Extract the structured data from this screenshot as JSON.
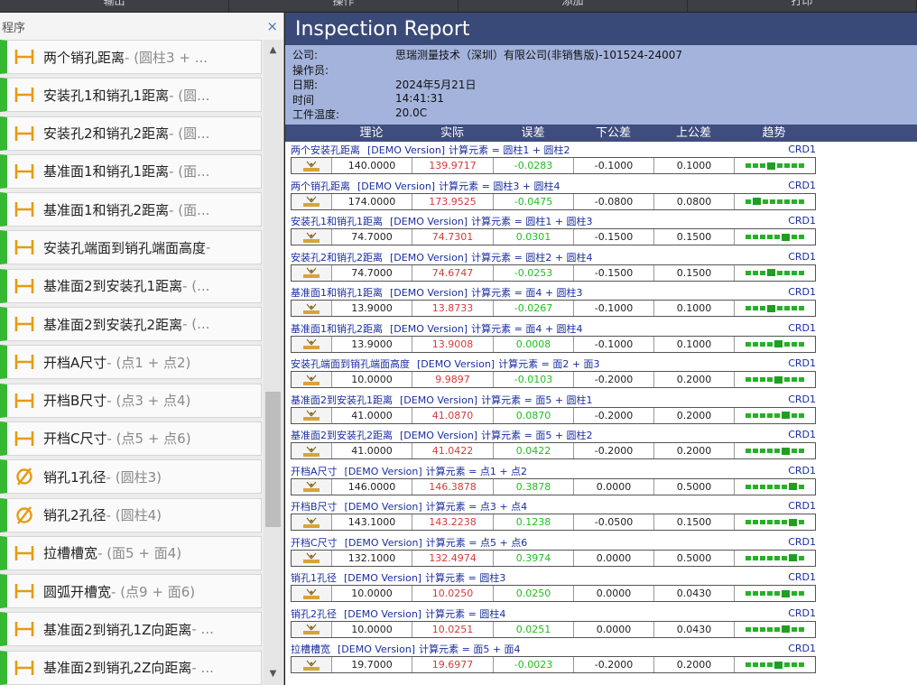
{
  "topbar": {
    "tabs": [
      "输出",
      "操作",
      "添加",
      "打印"
    ]
  },
  "left_panel": {
    "title": "程序",
    "close_glyph": "×",
    "scroll_up": "▲",
    "scroll_down": "▼",
    "items": [
      {
        "icon": "distance-icon",
        "name": "两个销孔距离",
        "detail": " - (圆柱3 + ..."
      },
      {
        "icon": "distance-icon",
        "name": "安装孔1和销孔1距离",
        "detail": " - (圆..."
      },
      {
        "icon": "distance-icon",
        "name": "安装孔2和销孔2距离",
        "detail": " - (圆..."
      },
      {
        "icon": "distance-icon",
        "name": "基准面1和销孔1距离",
        "detail": " - (面..."
      },
      {
        "icon": "distance-icon",
        "name": "基准面1和销孔2距离",
        "detail": " - (面..."
      },
      {
        "icon": "distance-icon",
        "name": "安装孔端面到销孔端面高度",
        "detail": " -"
      },
      {
        "icon": "distance-icon",
        "name": "基准面2到安装孔1距离",
        "detail": " - (..."
      },
      {
        "icon": "distance-icon",
        "name": "基准面2到安装孔2距离",
        "detail": " - (..."
      },
      {
        "icon": "distance-icon",
        "name": "开档A尺寸",
        "detail": " - (点1 + 点2)"
      },
      {
        "icon": "distance-icon",
        "name": "开档B尺寸",
        "detail": " - (点3 + 点4)"
      },
      {
        "icon": "distance-icon",
        "name": "开档C尺寸",
        "detail": " - (点5 + 点6)"
      },
      {
        "icon": "diameter-icon",
        "name": "销孔1孔径",
        "detail": " - (圆柱3)"
      },
      {
        "icon": "diameter-icon",
        "name": "销孔2孔径",
        "detail": " - (圆柱4)"
      },
      {
        "icon": "distance-icon",
        "name": "拉槽槽宽",
        "detail": " - (面5 + 面4)"
      },
      {
        "icon": "distance-icon",
        "name": "圆弧开槽宽",
        "detail": " - (点9 + 面6)"
      },
      {
        "icon": "distance-icon",
        "name": "基准面2到销孔1Z向距离",
        "detail": " - ..."
      },
      {
        "icon": "distance-icon",
        "name": "基准面2到销孔2Z向距离",
        "detail": " - ..."
      }
    ]
  },
  "report": {
    "title": "Inspection Report",
    "info": [
      {
        "label": "公司:",
        "value": "思瑞测量技术（深圳）有限公司(非销售版)-101524-24007"
      },
      {
        "label": "操作员:",
        "value": ""
      },
      {
        "label": "日期:",
        "value": "2024年5月21日"
      },
      {
        "label": "时间",
        "value": "14:41:31"
      },
      {
        "label": "工件温度:",
        "value": "20.0C"
      }
    ],
    "columns": [
      "理论",
      "实际",
      "误差",
      "下公差",
      "上公差",
      "趋势"
    ],
    "colors": {
      "header": "#3a4a78",
      "info_bg": "#a3b3dc",
      "actual": "#d63a3a",
      "error": "#1fbf1f"
    },
    "features": [
      {
        "name": "两个安装孔距离",
        "demo": "[DEMO Version]",
        "calc": "计算元素 = 圆柱1 + 圆柱2",
        "crd": "CRD1",
        "theory": "140.0000",
        "actual": "139.9717",
        "error": "-0.0283",
        "lower": "-0.1000",
        "upper": "0.1000",
        "trend": 3
      },
      {
        "name": "两个销孔距离",
        "demo": "[DEMO Version]",
        "calc": "计算元素 = 圆柱3 + 圆柱4",
        "crd": "CRD1",
        "theory": "174.0000",
        "actual": "173.9525",
        "error": "-0.0475",
        "lower": "-0.0800",
        "upper": "0.0800",
        "trend": 1
      },
      {
        "name": "安装孔1和销孔1距离",
        "demo": "[DEMO Version]",
        "calc": "计算元素 = 圆柱1 + 圆柱3",
        "crd": "CRD1",
        "theory": "74.7000",
        "actual": "74.7301",
        "error": "0.0301",
        "lower": "-0.1500",
        "upper": "0.1500",
        "trend": 5
      },
      {
        "name": "安装孔2和销孔2距离",
        "demo": "[DEMO Version]",
        "calc": "计算元素 = 圆柱2 + 圆柱4",
        "crd": "CRD1",
        "theory": "74.7000",
        "actual": "74.6747",
        "error": "-0.0253",
        "lower": "-0.1500",
        "upper": "0.1500",
        "trend": 3
      },
      {
        "name": "基准面1和销孔1距离",
        "demo": "[DEMO Version]",
        "calc": "计算元素 = 面4 + 圆柱3",
        "crd": "CRD1",
        "theory": "13.9000",
        "actual": "13.8733",
        "error": "-0.0267",
        "lower": "-0.1000",
        "upper": "0.1000",
        "trend": 3
      },
      {
        "name": "基准面1和销孔2距离",
        "demo": "[DEMO Version]",
        "calc": "计算元素 = 面4 + 圆柱4",
        "crd": "CRD1",
        "theory": "13.9000",
        "actual": "13.9008",
        "error": "0.0008",
        "lower": "-0.1000",
        "upper": "0.1000",
        "trend": 4
      },
      {
        "name": "安装孔端面到销孔端面高度",
        "demo": "[DEMO Version]",
        "calc": "计算元素 = 面2 + 面3",
        "crd": "CRD1",
        "theory": "10.0000",
        "actual": "9.9897",
        "error": "-0.0103",
        "lower": "-0.2000",
        "upper": "0.2000",
        "trend": 4
      },
      {
        "name": "基准面2到安装孔1距离",
        "demo": "[DEMO Version]",
        "calc": "计算元素 = 面5 + 圆柱1",
        "crd": "CRD1",
        "theory": "41.0000",
        "actual": "41.0870",
        "error": "0.0870",
        "lower": "-0.2000",
        "upper": "0.2000",
        "trend": 5
      },
      {
        "name": "基准面2到安装孔2距离",
        "demo": "[DEMO Version]",
        "calc": "计算元素 = 面5 + 圆柱2",
        "crd": "CRD1",
        "theory": "41.0000",
        "actual": "41.0422",
        "error": "0.0422",
        "lower": "-0.2000",
        "upper": "0.2000",
        "trend": 5
      },
      {
        "name": "开档A尺寸",
        "demo": "[DEMO Version]",
        "calc": "计算元素 = 点1 + 点2",
        "crd": "CRD1",
        "theory": "146.0000",
        "actual": "146.3878",
        "error": "0.3878",
        "lower": "0.0000",
        "upper": "0.5000",
        "trend": 6
      },
      {
        "name": "开档B尺寸",
        "demo": "[DEMO Version]",
        "calc": "计算元素 = 点3 + 点4",
        "crd": "CRD1",
        "theory": "143.1000",
        "actual": "143.2238",
        "error": "0.1238",
        "lower": "-0.0500",
        "upper": "0.1500",
        "trend": 6
      },
      {
        "name": "开档C尺寸",
        "demo": "[DEMO Version]",
        "calc": "计算元素 = 点5 + 点6",
        "crd": "CRD1",
        "theory": "132.1000",
        "actual": "132.4974",
        "error": "0.3974",
        "lower": "0.0000",
        "upper": "0.5000",
        "trend": 6
      },
      {
        "name": "销孔1孔径",
        "demo": "[DEMO Version]",
        "calc": "计算元素 = 圆柱3",
        "crd": "CRD1",
        "theory": "10.0000",
        "actual": "10.0250",
        "error": "0.0250",
        "lower": "0.0000",
        "upper": "0.0430",
        "trend": 5
      },
      {
        "name": "销孔2孔径",
        "demo": "[DEMO Version]",
        "calc": "计算元素 = 圆柱4",
        "crd": "CRD1",
        "theory": "10.0000",
        "actual": "10.0251",
        "error": "0.0251",
        "lower": "0.0000",
        "upper": "0.0430",
        "trend": 5
      },
      {
        "name": "拉槽槽宽",
        "demo": "[DEMO Version]",
        "calc": "计算元素 = 面5 + 面4",
        "crd": "CRD1",
        "theory": "19.7000",
        "actual": "19.6977",
        "error": "-0.0023",
        "lower": "-0.2000",
        "upper": "0.2000",
        "trend": 4
      }
    ]
  }
}
